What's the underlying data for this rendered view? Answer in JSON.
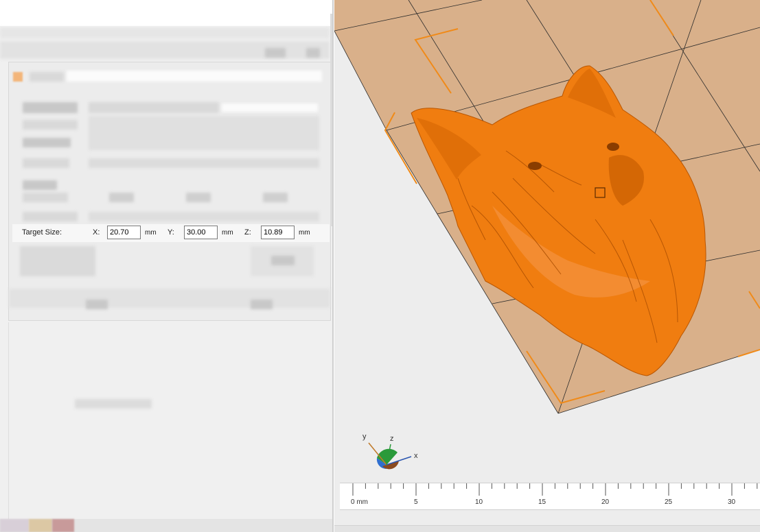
{
  "target_size": {
    "label": "Target Size:",
    "x_label": "X:",
    "x_value": "20.70",
    "y_label": "Y:",
    "y_value": "30.00",
    "z_label": "Z:",
    "z_value": "10.89",
    "unit": "mm"
  },
  "axis_gizmo": {
    "x": "x",
    "y": "y",
    "z": "z"
  },
  "ruler": {
    "ticks": [
      "0 mm",
      "5",
      "10",
      "15",
      "20",
      "25",
      "30"
    ]
  },
  "colors": {
    "model": "#f07d10",
    "bed": "#d9b08a",
    "bed_corner_marks": "#f08a18",
    "panel_bg": "#f0f0f0",
    "viewport_bg": "#ededed"
  },
  "icons": {
    "model_icon": "wolf-head-3d-model",
    "gizmo": "axis-orientation-gizmo"
  }
}
